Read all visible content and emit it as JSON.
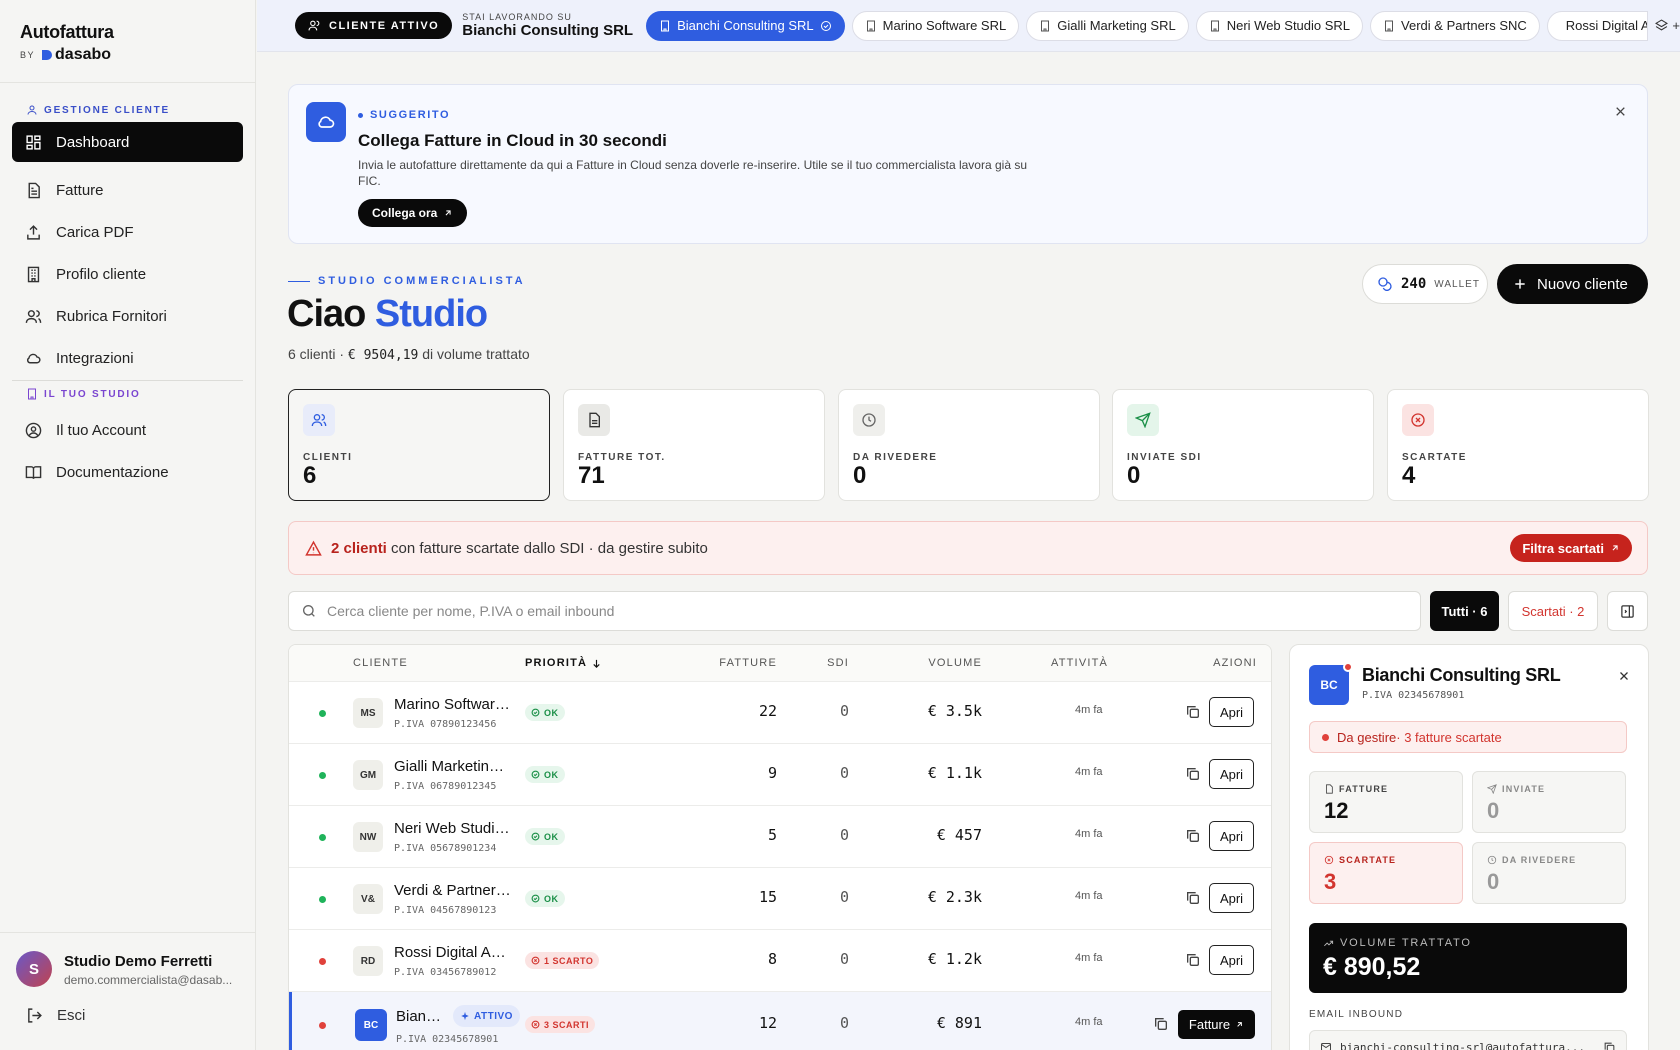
{
  "brand": {
    "name": "Autofattura",
    "by": "BY",
    "product": "dasabo"
  },
  "sidebar": {
    "section1": "GESTIONE CLIENTE",
    "items": [
      {
        "label": "Dashboard",
        "icon": "dashboard-icon",
        "active": true
      },
      {
        "label": "Fatture",
        "icon": "document-icon"
      },
      {
        "label": "Carica PDF",
        "icon": "upload-icon"
      },
      {
        "label": "Profilo cliente",
        "icon": "building-icon"
      },
      {
        "label": "Rubrica Fornitori",
        "icon": "users-icon"
      },
      {
        "label": "Integrazioni",
        "icon": "cloud-icon"
      }
    ],
    "section2": "IL TUO STUDIO",
    "items2": [
      {
        "label": "Il tuo Account",
        "icon": "user-circle-icon"
      },
      {
        "label": "Documentazione",
        "icon": "book-icon"
      }
    ],
    "user": {
      "initial": "S",
      "name": "Studio Demo Ferretti",
      "email": "demo.commercialista@dasab...",
      "logout": "Esci"
    }
  },
  "topbar": {
    "active_pill": "CLIENTE ATTIVO",
    "working_label": "STAI LAVORANDO SU",
    "working_client": "Bianchi Consulting SRL",
    "tabs": [
      "Bianchi Consulting SRL",
      "Marino Software SRL",
      "Gialli Marketing SRL",
      "Neri Web Studio SRL",
      "Verdi & Partners SNC",
      "Rossi Digital Ag"
    ],
    "more": "+"
  },
  "suggestion": {
    "tag": "SUGGERITO",
    "title": "Collega Fatture in Cloud in 30 secondi",
    "text": "Invia le autofatture direttamente da qui a Fatture in Cloud senza doverle re-inserire. Utile se il tuo commercialista lavora già su FIC.",
    "cta": "Collega ora"
  },
  "header": {
    "eyebrow": "STUDIO COMMERCIALISTA",
    "greet": "Ciao",
    "name": "Studio",
    "summary_pre": "6 clienti · ",
    "summary_amount": "€ 9504,19",
    "summary_post": " di volume trattato",
    "wallet_value": "240",
    "wallet_label": "WALLET",
    "new_client": "Nuovo cliente"
  },
  "stats": [
    {
      "label": "CLIENTI",
      "value": "6",
      "icon": "users-icon",
      "bg": "#e8ecfa",
      "color": "#2f5de0"
    },
    {
      "label": "FATTURE TOT.",
      "value": "71",
      "icon": "document-icon",
      "bg": "#ececea",
      "color": "#333"
    },
    {
      "label": "DA RIVEDERE",
      "value": "0",
      "icon": "clock-icon",
      "bg": "#ececea",
      "color": "#666"
    },
    {
      "label": "INVIATE SDI",
      "value": "0",
      "icon": "send-icon",
      "bg": "#e4f5ea",
      "color": "#1a8f47"
    },
    {
      "label": "SCARTATE",
      "value": "4",
      "icon": "x-circle-icon",
      "bg": "#fbe3e2",
      "color": "#d2352f"
    }
  ],
  "alert": {
    "bold": "2 clienti",
    "text": " con fatture scartate dallo SDI · da gestire subito",
    "cta": "Filtra scartati"
  },
  "search": {
    "placeholder": "Cerca cliente per nome, P.IVA o email inbound"
  },
  "filters": {
    "all": "Tutti · 6",
    "rejected": "Scartati · 2"
  },
  "table": {
    "headers": {
      "client": "CLIENTE",
      "priority": "PRIORITÀ",
      "invoices": "FATTURE",
      "sdi": "SDI",
      "volume": "VOLUME",
      "activity": "ATTIVITÀ",
      "actions": "AZIONI"
    },
    "rows": [
      {
        "initials": "MS",
        "name": "Marino Software SRL",
        "piva": "P.IVA 07890123456",
        "status": "OK",
        "ok": true,
        "invoices": "22",
        "sdi": "0",
        "volume": "€ 3.5k",
        "activity": "4m fa",
        "action": "Apri"
      },
      {
        "initials": "GM",
        "name": "Gialli Marketing SRL",
        "piva": "P.IVA 06789012345",
        "status": "OK",
        "ok": true,
        "invoices": "9",
        "sdi": "0",
        "volume": "€ 1.1k",
        "activity": "4m fa",
        "action": "Apri"
      },
      {
        "initials": "NW",
        "name": "Neri Web Studio SRL",
        "piva": "P.IVA 05678901234",
        "status": "OK",
        "ok": true,
        "invoices": "5",
        "sdi": "0",
        "volume": "€ 457",
        "activity": "4m fa",
        "action": "Apri"
      },
      {
        "initials": "V&",
        "name": "Verdi & Partners SNC",
        "piva": "P.IVA 04567890123",
        "status": "OK",
        "ok": true,
        "invoices": "15",
        "sdi": "0",
        "volume": "€ 2.3k",
        "activity": "4m fa",
        "action": "Apri"
      },
      {
        "initials": "RD",
        "name": "Rossi Digital Agency",
        "piva": "P.IVA 03456789012",
        "status": "1 SCARTO",
        "ok": false,
        "invoices": "8",
        "sdi": "0",
        "volume": "€ 1.2k",
        "activity": "4m fa",
        "action": "Apri"
      },
      {
        "initials": "BC",
        "name": "Bianchi Consulting SRL",
        "piva": "P.IVA 02345678901",
        "status": "3 SCARTI",
        "ok": false,
        "active_badge": "ATTIVO",
        "invoices": "12",
        "sdi": "0",
        "volume": "€ 891",
        "activity": "4m fa",
        "action": "Fatture"
      }
    ]
  },
  "detail": {
    "initials": "BC",
    "name": "Bianchi Consulting SRL",
    "piva": "P.IVA 02345678901",
    "status_bold": "Da gestire",
    "status_text": " · 3 fatture scartate",
    "cards": [
      {
        "label": "FATTURE",
        "value": "12",
        "icon": "document-icon"
      },
      {
        "label": "INVIATE",
        "value": "0",
        "icon": "send-icon"
      },
      {
        "label": "SCARTATE",
        "value": "3",
        "icon": "x-circle-icon"
      },
      {
        "label": "DA RIVEDERE",
        "value": "0",
        "icon": "clock-icon"
      }
    ],
    "volume_label": "VOLUME TRATTATO",
    "volume_value": "€ 890,52",
    "email_label": "EMAIL INBOUND",
    "email": "bianchi-consulting-srl@autofattura..."
  },
  "colors": {
    "accent": "#2f5de0",
    "danger": "#d2352f",
    "success": "#1a8f47",
    "dark": "#0a0a0a"
  }
}
